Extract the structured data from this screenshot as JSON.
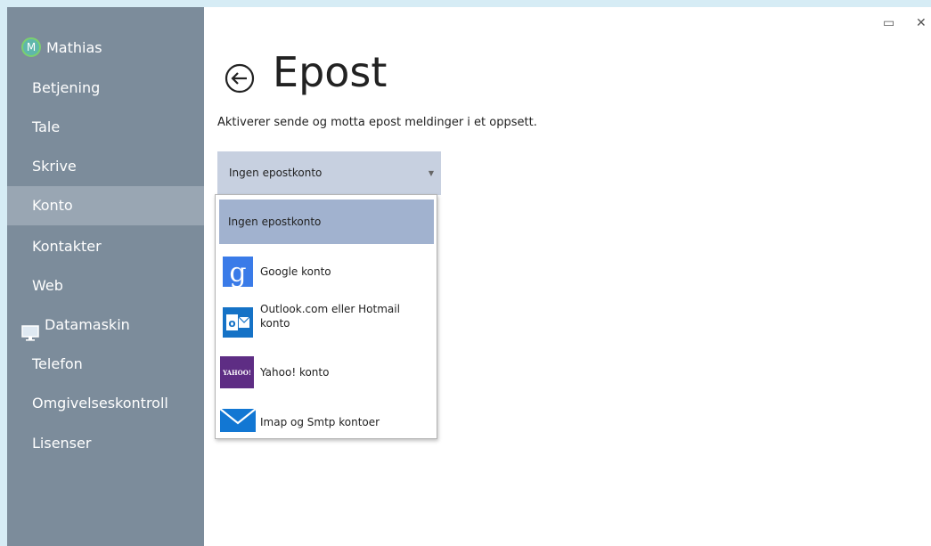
{
  "user": {
    "initial": "M",
    "name": "Mathias"
  },
  "sidebar": {
    "items": [
      {
        "label": "Betjening"
      },
      {
        "label": "Tale"
      },
      {
        "label": "Skrive"
      },
      {
        "label": "Konto"
      },
      {
        "label": "Kontakter"
      },
      {
        "label": "Web"
      },
      {
        "label": "Datamaskin"
      },
      {
        "label": "Telefon"
      },
      {
        "label": "Omgivelseskontroll"
      },
      {
        "label": "Lisenser"
      }
    ],
    "active": "Konto"
  },
  "window": {
    "maximize_glyph": "▭",
    "close_glyph": "✕"
  },
  "page": {
    "title": "Epost",
    "subtitle": "Aktiverer sende og motta epost meldinger i et oppsett."
  },
  "account_select": {
    "value": "Ingen epostkonto",
    "options": [
      {
        "label": "Ingen epostkonto",
        "icon": "none"
      },
      {
        "label": "Google konto",
        "icon": "google-icon"
      },
      {
        "label": "Outlook.com eller Hotmail konto",
        "icon": "outlook-icon"
      },
      {
        "label": "Yahoo! konto",
        "icon": "yahoo-icon"
      },
      {
        "label": "Imap og Smtp kontoer",
        "icon": "mail-icon"
      }
    ]
  },
  "colors": {
    "sidebar": "#7c8c9b",
    "sidebar_active": "#99a6b3",
    "select_bg": "#c7d0e0",
    "option_selected": "#a1b2cf",
    "google_blue": "#3a7be8",
    "outlook_blue": "#1572c6",
    "yahoo_purple": "#5e2d84",
    "mail_blue": "#1277d3"
  }
}
